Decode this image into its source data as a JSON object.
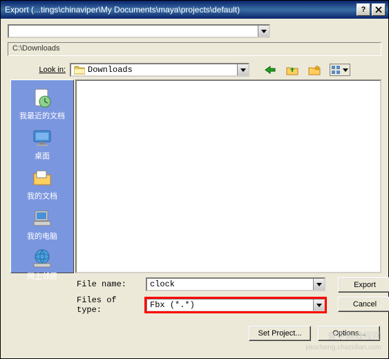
{
  "title": "Export (...tings\\chinaviper\\My Documents\\maya\\projects\\default)",
  "path_display": "C:\\Downloads",
  "lookin_label": "Look in:",
  "lookin_value": "Downloads",
  "sidebar": {
    "items": [
      {
        "label": "我最近的文档"
      },
      {
        "label": "桌面"
      },
      {
        "label": "我的文档"
      },
      {
        "label": "我的电脑"
      },
      {
        "label": "网上邻居"
      }
    ]
  },
  "filename_label": "File name:",
  "filename_value": "clock",
  "filetype_label": "Files of type:",
  "filetype_value": "Fbx (*.*)",
  "buttons": {
    "export": "Export",
    "cancel": "Cancel",
    "set_project": "Set Project...",
    "options": "Options..."
  },
  "watermark_main": "查字典教程网",
  "watermark_sub": "jiaocheng.chazidian.com"
}
